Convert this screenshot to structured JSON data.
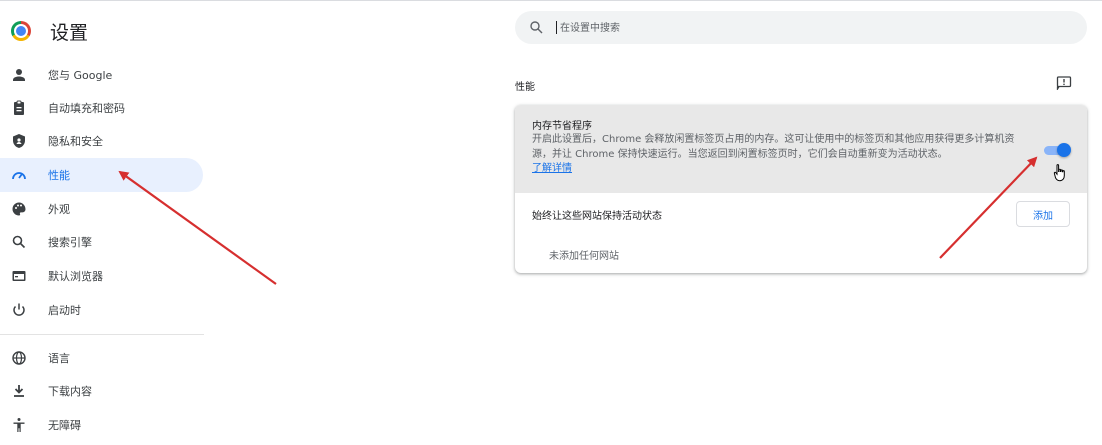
{
  "header": {
    "title": "设置"
  },
  "sidebar": {
    "items": [
      {
        "label": "您与 Google",
        "icon": "person-icon"
      },
      {
        "label": "自动填充和密码",
        "icon": "clipboard-icon"
      },
      {
        "label": "隐私和安全",
        "icon": "shield-icon"
      },
      {
        "label": "性能",
        "icon": "speedometer-icon",
        "active": true
      },
      {
        "label": "外观",
        "icon": "palette-icon"
      },
      {
        "label": "搜索引擎",
        "icon": "search-icon"
      },
      {
        "label": "默认浏览器",
        "icon": "browser-icon"
      },
      {
        "label": "启动时",
        "icon": "power-icon"
      },
      {
        "label": "语言",
        "icon": "globe-icon"
      },
      {
        "label": "下载内容",
        "icon": "download-icon"
      },
      {
        "label": "无障碍",
        "icon": "accessibility-icon"
      }
    ]
  },
  "search": {
    "placeholder": "在设置中搜索"
  },
  "section": {
    "title": "性能"
  },
  "memory_saver": {
    "title": "内存节省程序",
    "description": "开启此设置后，Chrome 会释放闲置标签页占用的内存。这可让使用中的标签页和其他应用获得更多计算机资源，并让 Chrome 保持快速运行。当您返回到闲置标签页时，它们会自动重新变为活动状态。",
    "learn_more": "了解详情",
    "enabled": true
  },
  "always_active": {
    "label": "始终让这些网站保持活动状态",
    "add_button": "添加",
    "empty_text": "未添加任何网站"
  },
  "colors": {
    "accent": "#1a73e8",
    "arrow": "#d62f2f",
    "active_bg": "#e8f0fe"
  }
}
